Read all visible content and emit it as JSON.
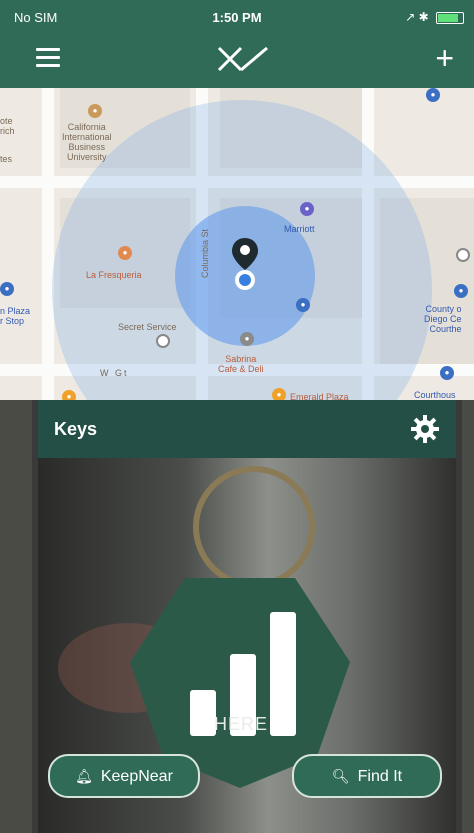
{
  "status_bar": {
    "carrier": "No SIM",
    "time": "1:50 PM",
    "right": "↗ ✱"
  },
  "header": {
    "logo_icon": "xy-logo-icon",
    "menu_icon": "hamburger-icon",
    "add_label": "+"
  },
  "map": {
    "labels": {
      "california_university": "California\nInternational\nBusiness\nUniversity",
      "la_fresqueria": "La Fresqueria",
      "marriott": "Marriott",
      "secret_service": "Secret Service",
      "sabrina_cafe": "Sabrina\nCafe & Deli",
      "emerald_plaza": "Emerald Plaza",
      "county_of_sd": "County o\nDiego Ce\nCourthe",
      "courthouse": "Courthous",
      "plaza_stop": "n Plaza\nr Stop",
      "street_columbia": "Columbia St",
      "street_w": "W Gt",
      "left_edge_top": "ote\nrich",
      "left_edge_mid": "tes"
    }
  },
  "card": {
    "title": "Keys",
    "status_text": "HERE",
    "signal_level": 3,
    "keepnear_label": "KeepNear",
    "findit_label": "Find It"
  },
  "colors": {
    "header": "#2f6b57",
    "card_header": "#234f46",
    "tag_green": "#2c5a49"
  }
}
